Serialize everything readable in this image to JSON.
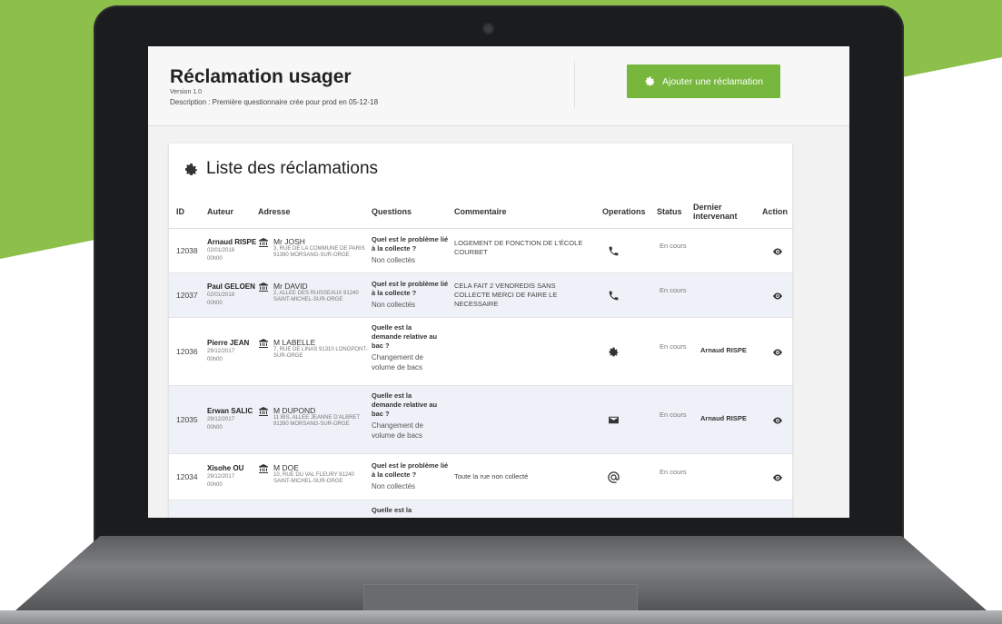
{
  "page": {
    "title": "Réclamation usager",
    "version": "Version 1.0",
    "description": "Description : Première questionnaire crée pour prod en 05-12-18"
  },
  "toolbar": {
    "add_label": "Ajouter une réclamation"
  },
  "list": {
    "title": "Liste des réclamations",
    "columns": {
      "id": "ID",
      "author": "Auteur",
      "address": "Adresse",
      "questions": "Questions",
      "comment": "Commentaire",
      "operations": "Operations",
      "status": "Status",
      "last_agent": "Dernier intervenant",
      "action": "Action"
    },
    "rows": [
      {
        "id": "12038",
        "author": "Arnaud RISPE",
        "date": "02/01/2018",
        "time": "00h00",
        "addr_name": "Mr JOSH",
        "addr_line1": "3, RUE DE LA COMMUNE DE PARIS",
        "addr_line2": "91390 MORSANG-SUR-ORGE",
        "question": "Quel est le problème lié à la collecte ?",
        "answer": "Non collectés",
        "comment": "LOGEMENT DE FONCTION DE L'ÉCOLE COURBET",
        "operation_icon": "phone-icon",
        "status": "En cours",
        "last_agent": ""
      },
      {
        "id": "12037",
        "author": "Paul GELOEN",
        "date": "02/01/2018",
        "time": "00h00",
        "addr_name": "Mr DAVID",
        "addr_line1": "2, ALLEE DES RUISSEAUX 91240",
        "addr_line2": "SAINT-MICHEL-SUR-ORGE",
        "question": "Quel est le problème lié à la collecte ?",
        "answer": "Non collectés",
        "comment": "CELA FAIT 2 VENDREDIS SANS COLLECTE MERCI DE FAIRE LE NECESSAIRE",
        "operation_icon": "phone-icon",
        "status": "En cours",
        "last_agent": ""
      },
      {
        "id": "12036",
        "author": "Pierre JEAN",
        "date": "29/12/2017",
        "time": "00h00",
        "addr_name": "M LABELLE",
        "addr_line1": "7, RUE DE LINAS 91310 LONGPONT-",
        "addr_line2": "SUR-ORGE",
        "question": "Quelle est la demande relative au bac ?",
        "answer": "Changement de volume de bacs",
        "comment": "",
        "operation_icon": "gear-icon",
        "status": "En cours",
        "last_agent": "Arnaud RISPE"
      },
      {
        "id": "12035",
        "author": "Erwan SALIC",
        "date": "29/12/2017",
        "time": "00h00",
        "addr_name": "M DUPOND",
        "addr_line1": "11 BIS, ALLEE JEANNE D'ALBRET",
        "addr_line2": "91390 MORSANG-SUR-ORGE",
        "question": "Quelle est la demande relative au bac ?",
        "answer": "Changement de volume de bacs",
        "comment": "",
        "operation_icon": "envelope-icon",
        "status": "En cours",
        "last_agent": "Arnaud RISPE"
      },
      {
        "id": "12034",
        "author": "Xisohe OU",
        "date": "29/12/2017",
        "time": "00h00",
        "addr_name": "M DOE",
        "addr_line1": "10, RUE DU VAL FLEURY 91240",
        "addr_line2": "SAINT-MICHEL-SUR-ORGE",
        "question": "Quel est le problème lié à la collecte ?",
        "answer": "Non collectés",
        "comment": "Toute la rue non collecté",
        "operation_icon": "at-icon",
        "status": "En cours",
        "last_agent": ""
      }
    ],
    "next_row_question": "Quelle est la"
  },
  "colors": {
    "brand_green": "#8cc04b",
    "button_green": "#77b73e",
    "row_alt": "#eef1f7"
  }
}
